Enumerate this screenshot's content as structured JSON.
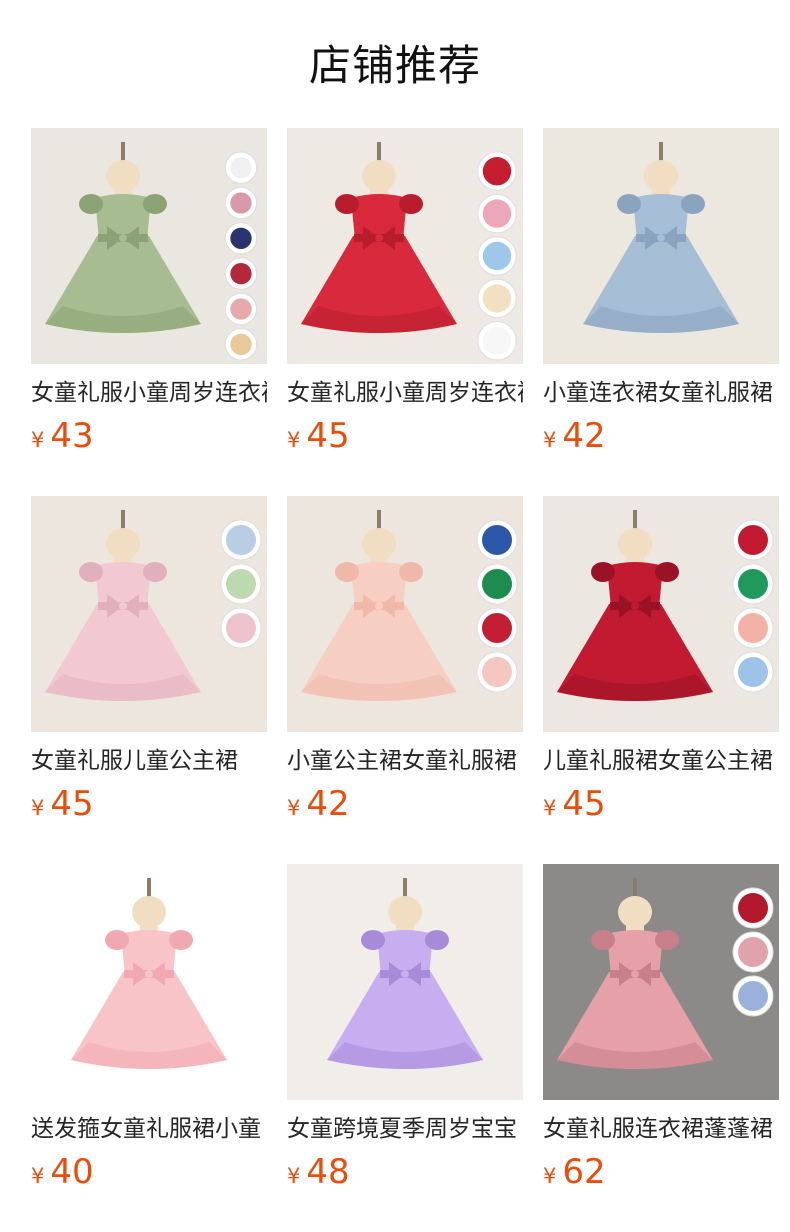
{
  "page_title": "店铺推荐",
  "currency_symbol": "¥",
  "products": [
    {
      "name": "女童礼服小童周岁连衣裙",
      "price": "43",
      "icon": "green-dress-image",
      "bg": "#eae6e0",
      "dress": "#a7bc90",
      "dress_dark": "#8aa274",
      "swatches": [
        "#f0f0f0",
        "#d89aa8",
        "#27346e",
        "#b3283a",
        "#e7a9a9",
        "#e9c999"
      ]
    },
    {
      "name": "女童礼服小童周岁连衣裙",
      "price": "45",
      "icon": "red-dress-image",
      "bg": "#efe9e3",
      "dress": "#d82a3c",
      "dress_dark": "#b81d2e",
      "swatches": [
        "#c41e30",
        "#eea7b8",
        "#9ec8ea",
        "#f1e0c2",
        "#f7f7f7"
      ]
    },
    {
      "name": "小童连衣裙女童礼服裙",
      "price": "42",
      "icon": "blue-dress-image",
      "bg": "#ece7df",
      "dress": "#a5bdd5",
      "dress_dark": "#8aa3be",
      "swatches": []
    },
    {
      "name": "女童礼服儿童公主裙",
      "price": "45",
      "icon": "pink-dress-image",
      "bg": "#ece6df",
      "dress": "#f2c9d3",
      "dress_dark": "#e2b0bd",
      "swatches": [
        "#b9cde4",
        "#bcd9b0",
        "#efc3cd"
      ]
    },
    {
      "name": "小童公主裙女童礼服裙",
      "price": "42",
      "icon": "peach-dress-image",
      "bg": "#ece6df",
      "dress": "#f7cfc2",
      "dress_dark": "#efb8a9",
      "swatches": [
        "#2d57a8",
        "#1e8c4e",
        "#c21e34",
        "#f4c8c0"
      ]
    },
    {
      "name": "儿童礼服裙女童公主裙",
      "price": "45",
      "icon": "sequin-red-dress-image",
      "bg": "#ece7e0",
      "dress": "#c21b31",
      "dress_dark": "#9a1226",
      "swatches": [
        "#c21b31",
        "#1f9a5a",
        "#f4b1a6",
        "#9dc3e8"
      ]
    },
    {
      "name": "送发箍女童礼服裙小童",
      "price": "40",
      "icon": "light-pink-dress-image",
      "bg": "#ffffff",
      "dress": "#f8c4c8",
      "dress_dark": "#f0a9b0",
      "swatches": []
    },
    {
      "name": "女童跨境夏季周岁宝宝",
      "price": "48",
      "icon": "purple-dress-image",
      "bg": "#f1ede9",
      "dress": "#c7aef0",
      "dress_dark": "#a78ad8",
      "swatches": []
    },
    {
      "name": "女童礼服连衣裙蓬蓬裙",
      "price": "62",
      "icon": "lace-pink-dress-image",
      "bg": "#8b8a89",
      "dress": "#e5a0a8",
      "dress_dark": "#c97f89",
      "swatches": [
        "#b3182d",
        "#e1a3ab",
        "#9ab2da"
      ]
    }
  ]
}
